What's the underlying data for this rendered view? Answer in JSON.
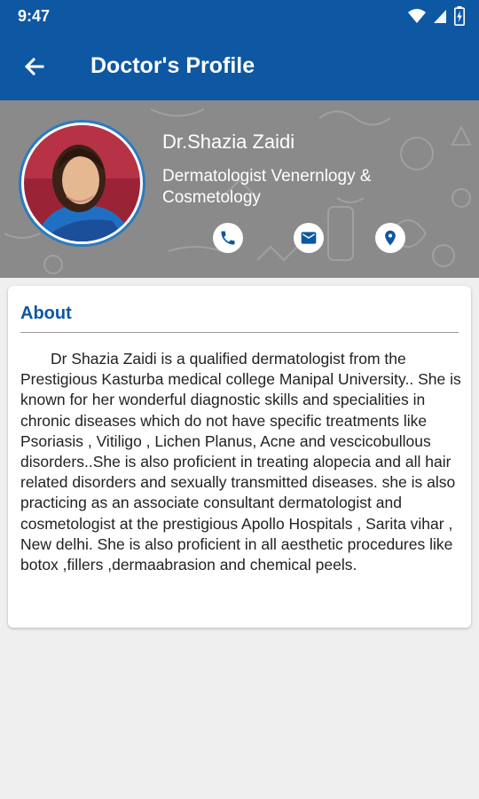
{
  "status": {
    "time": "9:47"
  },
  "header": {
    "title": "Doctor's Profile"
  },
  "doctor": {
    "name": "Dr.Shazia Zaidi",
    "speciality": "Dermatologist Venernlogy & Cosmetology",
    "actions": [
      "phone-icon",
      "mail-icon",
      "location-icon"
    ]
  },
  "about": {
    "title": "About",
    "text": "Dr Shazia Zaidi is a qualified dermatologist from the Prestigious Kasturba medical college Manipal University.. She is known for her wonderful diagnostic skills and specialities in chronic diseases which do not have specific treatments like Psoriasis , Vitiligo , Lichen Planus, Acne and vescicobullous disorders..She is also proficient in treating alopecia and all hair related disorders and sexually transmitted diseases. she is also practicing as an associate consultant dermatologist and cosmetologist at the prestigious Apollo Hospitals , Sarita vihar , New delhi. She is also proficient in all aesthetic procedures like botox ,fillers ,dermaabrasion and chemical peels."
  },
  "colors": {
    "primary": "#0d57a3",
    "hero_bg": "#8a8a8a",
    "background": "#efefef"
  }
}
